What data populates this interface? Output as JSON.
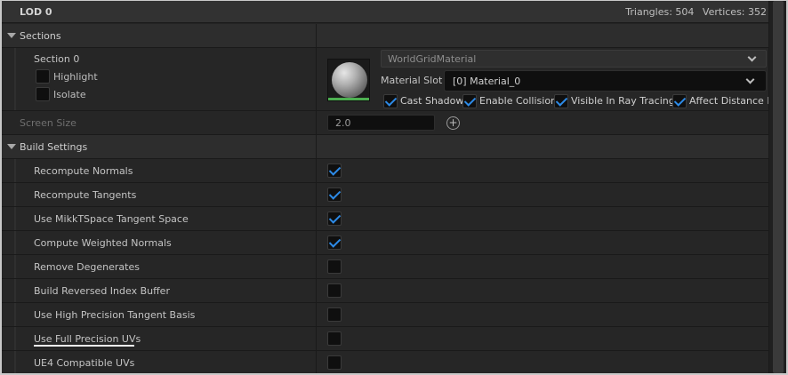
{
  "lod": {
    "title": "LOD 0",
    "triangles": "Triangles: 504",
    "vertices": "Vertices: 352"
  },
  "sections": {
    "header": "Sections",
    "section_name": "Section 0",
    "highlight_label": "Highlight",
    "isolate_label": "Isolate",
    "material_name": "WorldGridMaterial",
    "material_slot_label": "Material Slot",
    "material_slot_value": "[0] Material_0",
    "options": [
      {
        "label": "Cast Shadow",
        "checked": true
      },
      {
        "label": "Enable Collision",
        "checked": true
      },
      {
        "label": "Visible In Ray Tracing",
        "checked": true
      },
      {
        "label": "Affect Distance F",
        "checked": true
      }
    ],
    "screen_size_label": "Screen Size",
    "screen_size_value": "2.0",
    "add_icon": "+"
  },
  "build_settings": {
    "header": "Build Settings",
    "rows": [
      {
        "label": "Recompute Normals",
        "checked": true
      },
      {
        "label": "Recompute Tangents",
        "checked": true
      },
      {
        "label": "Use MikkTSpace Tangent Space",
        "checked": true
      },
      {
        "label": "Compute Weighted Normals",
        "checked": true
      },
      {
        "label": "Remove Degenerates",
        "checked": false
      },
      {
        "label": "Build Reversed Index Buffer",
        "checked": false
      },
      {
        "label": "Use High Precision Tangent Basis",
        "checked": false
      },
      {
        "label": "Use Full Precision UVs",
        "checked": false
      },
      {
        "label": "UE4 Compatible UVs",
        "checked": false
      }
    ]
  },
  "colors": {
    "accent": "#2d8ae6",
    "thumbnail_bar": "#4caf50"
  }
}
